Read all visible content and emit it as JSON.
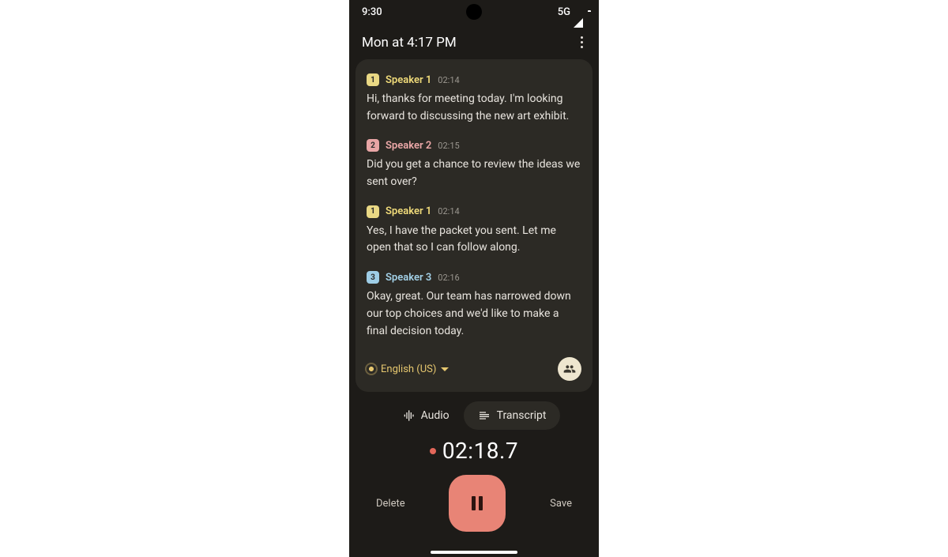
{
  "status": {
    "time": "9:30",
    "network": "5G"
  },
  "header": {
    "title": "Mon at 4:17 PM"
  },
  "speakerColors": {
    "1": {
      "bg": "#e9d884",
      "text": "#f0db7a"
    },
    "2": {
      "bg": "#e8a5a5",
      "text": "#eda9a9"
    },
    "3": {
      "bg": "#9ecde6",
      "text": "#a3d1e8"
    }
  },
  "entries": [
    {
      "speakerId": "1",
      "name": "Speaker 1",
      "time": "02:14",
      "text": "Hi, thanks for meeting today. I'm looking forward to discussing the new art exhibit."
    },
    {
      "speakerId": "2",
      "name": "Speaker 2",
      "time": "02:15",
      "text": "Did you get a chance to review the ideas we sent over?"
    },
    {
      "speakerId": "1",
      "name": "Speaker 1",
      "time": "02:14",
      "text": "Yes, I have the packet you sent. Let me open that so I can follow along."
    },
    {
      "speakerId": "3",
      "name": "Speaker 3",
      "time": "02:16",
      "text": "Okay, great. Our team has narrowed down our top choices and we'd like to make a final decision today."
    }
  ],
  "language": "English (US)",
  "segments": {
    "audio": "Audio",
    "transcript": "Transcript",
    "active": "transcript"
  },
  "timer": "02:18.7",
  "actions": {
    "delete": "Delete",
    "save": "Save"
  }
}
